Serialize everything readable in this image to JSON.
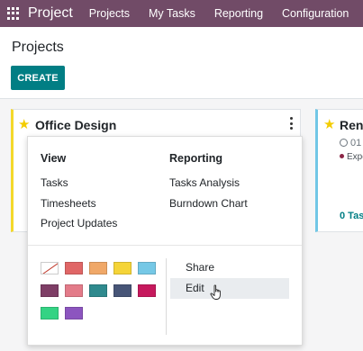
{
  "navbar": {
    "brand": "Project",
    "menu": [
      "Projects",
      "My Tasks",
      "Reporting",
      "Configuration"
    ],
    "color": "#714b67"
  },
  "control_panel": {
    "title": "Projects",
    "create_label": "CREATE",
    "create_color": "#017e84"
  },
  "cards": [
    {
      "title": "Office Design",
      "favorite": true,
      "color": "#f4d82b"
    },
    {
      "title": "Renc",
      "favorite": true,
      "date": "01",
      "status": "Expe",
      "tasks": "0 Tas",
      "color": "#71c7e6"
    }
  ],
  "dropdown": {
    "view": {
      "heading": "View",
      "items": [
        "Tasks",
        "Timesheets",
        "Project Updates"
      ]
    },
    "reporting": {
      "heading": "Reporting",
      "items": [
        "Tasks Analysis",
        "Burndown Chart"
      ]
    },
    "colors": [
      "none",
      "#e06666",
      "#f0a868",
      "#f5d438",
      "#75c8e6",
      "#7e3e66",
      "#e37b89",
      "#2f8a8e",
      "#475577",
      "#c6195d",
      "#34d384",
      "#8c55bf"
    ],
    "actions": [
      {
        "label": "Share",
        "hovered": false
      },
      {
        "label": "Edit",
        "hovered": true
      }
    ]
  },
  "icons": {
    "apps": "apps-grid-icon",
    "favorite": "star-icon",
    "menu": "vertical-dots-icon",
    "date": "clock-icon",
    "cursor": "hand-pointer-icon"
  }
}
